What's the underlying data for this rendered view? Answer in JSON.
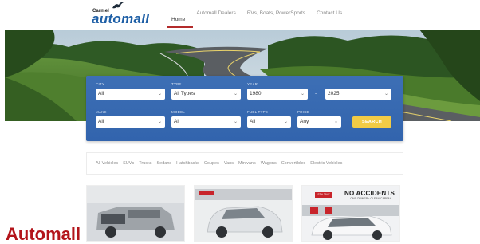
{
  "header": {
    "logo_small": "Carmel",
    "logo_big": "automall",
    "nav": [
      {
        "label": "Home",
        "active": true
      },
      {
        "label": "Automall Dealers",
        "active": false
      },
      {
        "label": "RVs, Boats, PowerSports",
        "active": false
      },
      {
        "label": "Contact Us",
        "active": false
      }
    ]
  },
  "search": {
    "city": {
      "label": "CITY",
      "value": "All"
    },
    "type": {
      "label": "TYPE",
      "value": "All Types"
    },
    "year": {
      "label": "YEAR",
      "from": "1980",
      "to": "2025",
      "separator": "-"
    },
    "make": {
      "label": "MAKE",
      "value": "All"
    },
    "model": {
      "label": "MODEL",
      "value": "All"
    },
    "fuel_type": {
      "label": "FUEL TYPE",
      "value": "All"
    },
    "price": {
      "label": "PRICE",
      "value": "Any"
    },
    "button_label": "SEARCH"
  },
  "categories": [
    "All Vehicles",
    "SUVs",
    "Trucks",
    "Sedans",
    "Hatchbacks",
    "Coupes",
    "Vans",
    "Minivans",
    "Wagons",
    "Convertibles",
    "Electric Vehicles"
  ],
  "cards": {
    "third": {
      "headline": "NO ACCIDENTS",
      "subline": "ONE OWNER • CLEAN CARFAX",
      "tag": "ST# 3947"
    }
  },
  "page_heading": "Automall",
  "colors": {
    "accent_red": "#b3151b",
    "panel_blue": "#3565ae",
    "search_yellow": "#f2cb45",
    "logo_blue": "#1e5fa6"
  }
}
